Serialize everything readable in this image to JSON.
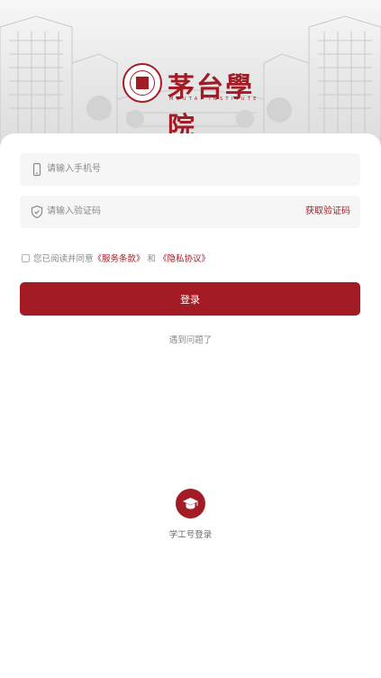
{
  "header": {
    "logo_cn": "茅台學院",
    "logo_en": "MOUTAI INSTITUTE"
  },
  "form": {
    "phone_placeholder": "请输入手机号",
    "code_placeholder": "请输入验证码",
    "get_code_label": "获取验证码"
  },
  "agreement": {
    "prefix": "您已阅读并同意",
    "service_terms": "《服务条款》",
    "conjunction": "和",
    "privacy_policy": "《隐私协议》",
    "checked": false
  },
  "login_button": "登录",
  "help_link": "遇到问题了",
  "alt_login": {
    "label": "学工号登录",
    "icon": "graduation-cap-icon"
  },
  "colors": {
    "accent": "#a31c25",
    "field_bg": "#f6f6f6",
    "muted_text": "#8a8a8a"
  }
}
